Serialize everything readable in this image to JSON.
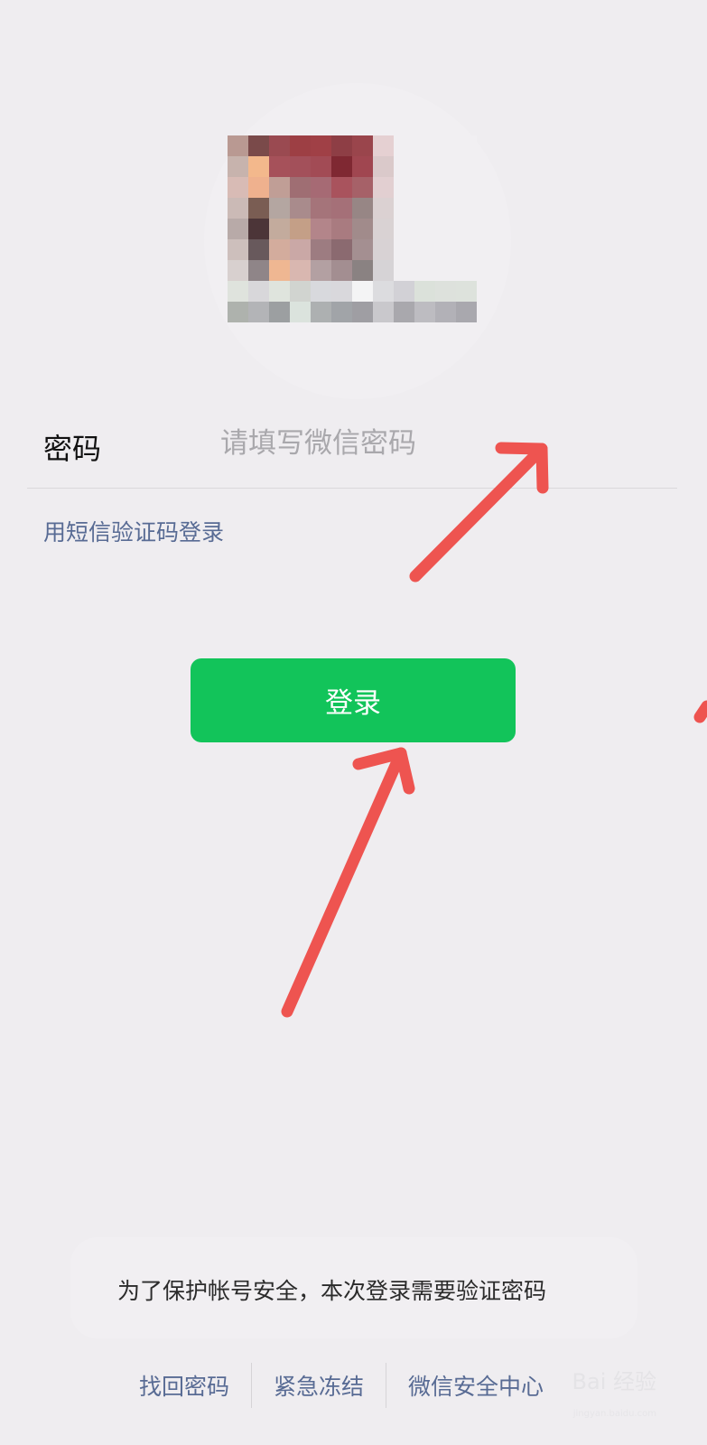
{
  "login": {
    "password_label": "密码",
    "password_placeholder": "请填写微信密码",
    "sms_login_link": "用短信验证码登录",
    "login_button": "登录"
  },
  "notice": {
    "message": "为了保护帐号安全，本次登录需要验证密码"
  },
  "footer": {
    "links": [
      {
        "label": "找回密码"
      },
      {
        "label": "紧急冻结"
      },
      {
        "label": "微信安全中心"
      }
    ]
  },
  "watermark": {
    "text": "Bai 经验",
    "subtext": "jingyan.baidu.com"
  },
  "colors": {
    "primary_green": "#12c45a",
    "link_blue": "#586b94",
    "background": "#efedf0",
    "annotation_red": "#ee5450"
  },
  "avatar_pixels": [
    [
      "#b99992",
      "#7a4a4a",
      "#9a4a51",
      "#9d3f44",
      "#a04046",
      "#8e3e45",
      "#9a454c",
      "#e5d0d2",
      "#f1eff2",
      "#f1eff2",
      "#f1eff2",
      "#f1eff2"
    ],
    [
      "#c7b3ad",
      "#f3b88c",
      "#a6515a",
      "#a3505a",
      "#a24b55",
      "#7f2832",
      "#a04650",
      "#dac9ca",
      "#f1eff2",
      "#f1eff2",
      "#f1eff2",
      "#f1eff2"
    ],
    [
      "#d8bbb5",
      "#efb18e",
      "#c09e96",
      "#9f6e73",
      "#a66a74",
      "#a9535d",
      "#a66168",
      "#e2cfd1",
      "#f1eff2",
      "#f1eff2",
      "#f1eff2",
      "#f1eff2"
    ],
    [
      "#cbbab6",
      "#7a5d53",
      "#b4a6a1",
      "#a98b8c",
      "#a5747a",
      "#a57078",
      "#978685",
      "#dbd1d2",
      "#f1eff2",
      "#f1eff2",
      "#f1eff2",
      "#f1eff2"
    ],
    [
      "#b8aaa8",
      "#4c3538",
      "#c3ab9d",
      "#c49f87",
      "#b3858a",
      "#a97b80",
      "#a18b8b",
      "#d9d2d3",
      "#f1eff2",
      "#f1eff2",
      "#f1eff2",
      "#f1eff2"
    ],
    [
      "#cdbfbc",
      "#68595c",
      "#d3ac9d",
      "#caa8a6",
      "#9d7c81",
      "#8b6a70",
      "#a48f91",
      "#d8d2d4",
      "#f1eff2",
      "#f1eff2",
      "#f1eff2",
      "#f1eff2"
    ],
    [
      "#d8d0cf",
      "#8f8588",
      "#efb792",
      "#d9b7b0",
      "#b3a0a2",
      "#a38e91",
      "#8a8282",
      "#d6d3d6",
      "#f1eff2",
      "#f1eff2",
      "#f1eff2",
      "#f1eff2"
    ],
    [
      "#dfe3dd",
      "#d8d7da",
      "#dfe4dd",
      "#d1d4d0",
      "#d8d9dd",
      "#d9d8dc",
      "#f4f4f5",
      "#dcdcdf",
      "#d2d1d6",
      "#dbe1da",
      "#dde1dc",
      "#dde2dc"
    ],
    [
      "#aeb2ad",
      "#b3b4b7",
      "#9c9fa1",
      "#dbe3dd",
      "#adb0b1",
      "#a1a4a8",
      "#9f9ea3",
      "#c9c8cc",
      "#a9a8ad",
      "#bdbcc1",
      "#b2b1b7",
      "#a9a8ae"
    ]
  ]
}
